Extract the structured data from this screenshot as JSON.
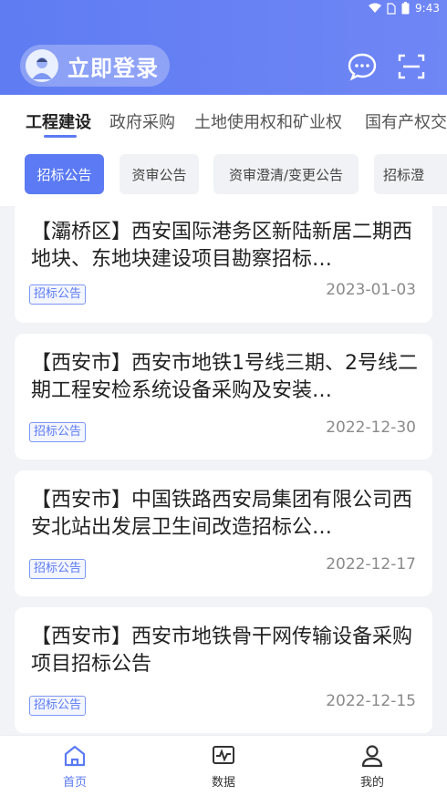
{
  "status_bar": {
    "time": "9:43"
  },
  "header": {
    "login_label": "立即登录",
    "icons": [
      "avatar-icon",
      "message-icon",
      "scan-icon"
    ]
  },
  "tabs": [
    {
      "label": "工程建设",
      "active": true
    },
    {
      "label": "政府采购",
      "active": false
    },
    {
      "label": "土地使用权和矿业权",
      "active": false
    },
    {
      "label": "国有产权交",
      "active": false
    }
  ],
  "chips": [
    {
      "label": "招标公告",
      "active": true
    },
    {
      "label": "资审公告",
      "active": false
    },
    {
      "label": "资审澄清/变更公告",
      "active": false
    },
    {
      "label": "招标澄",
      "active": false
    }
  ],
  "items": [
    {
      "title": "【灞桥区】西安国际港务区新陆新居二期西地块、东地块建设项目勘察招标…",
      "tag": "招标公告",
      "date": "2023-01-03"
    },
    {
      "title": "【西安市】西安市地铁1号线三期、2号线二期工程安检系统设备采购及安装…",
      "tag": "招标公告",
      "date": "2022-12-30"
    },
    {
      "title": "【西安市】中国铁路西安局集团有限公司西安北站出发层卫生间改造招标公…",
      "tag": "招标公告",
      "date": "2022-12-17"
    },
    {
      "title": "【西安市】西安市地铁骨干网传输设备采购项目招标公告",
      "tag": "招标公告",
      "date": "2022-12-15"
    }
  ],
  "bottom_nav": [
    {
      "label": "首页",
      "icon": "home-icon",
      "active": true
    },
    {
      "label": "数据",
      "icon": "data-icon",
      "active": false
    },
    {
      "label": "我的",
      "icon": "profile-icon",
      "active": false
    }
  ],
  "colors": {
    "accent": "#5b7af3",
    "header": "#6a82f4"
  }
}
